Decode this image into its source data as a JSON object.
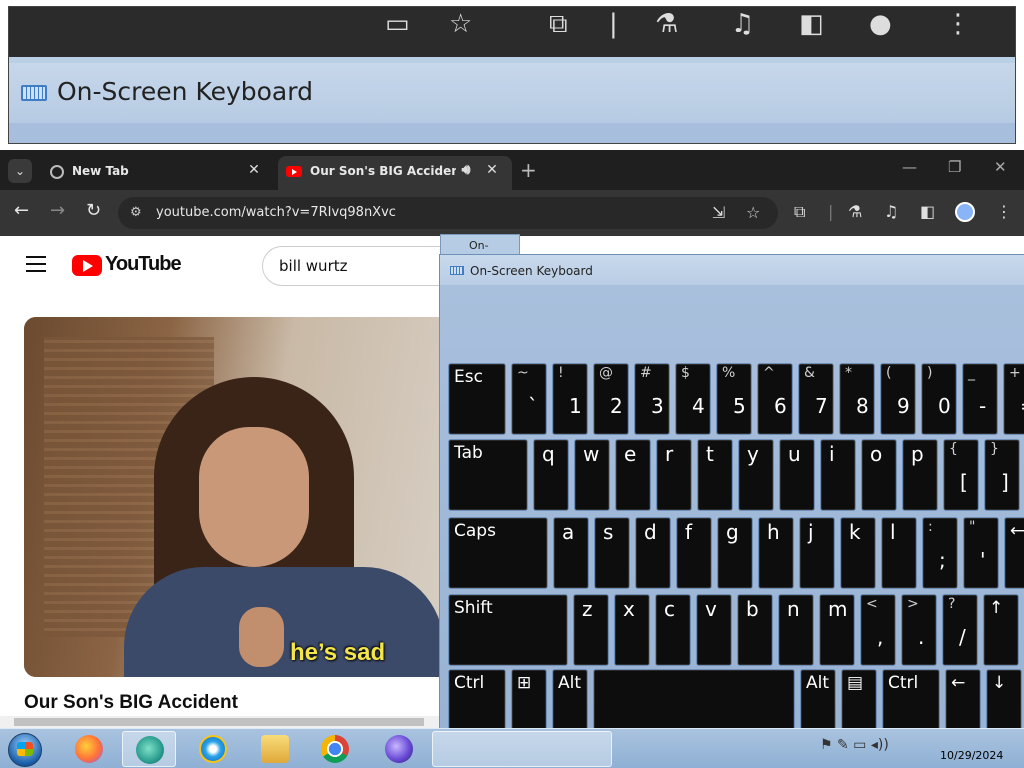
{
  "magnifier": {
    "title": "On-Screen Keyboard"
  },
  "chrome": {
    "tabs": [
      {
        "label": "New Tab",
        "close": "✕"
      },
      {
        "label": "Our Son's BIG Accident - Yo",
        "close": "✕"
      }
    ],
    "new_tab": "+",
    "window_controls": {
      "minimize": "—",
      "restore": "❐",
      "close": "✕"
    },
    "nav": {
      "back": "←",
      "forward": "→",
      "reload": "↻"
    },
    "url": "youtube.com/watch?v=7RIvq98nXvc"
  },
  "youtube": {
    "logo_text": "YouTube",
    "search_value": "bill wurtz",
    "caption": "he’s sad",
    "video_title": "Our Son's BIG Accident"
  },
  "osk": {
    "back_title": "On-Screen",
    "title": "On-Screen Keyboard",
    "rows": [
      [
        {
          "main": "Esc",
          "word": true
        },
        {
          "sub": "~",
          "main": "`"
        },
        {
          "sub": "!",
          "main": "1"
        },
        {
          "sub": "@",
          "main": "2"
        },
        {
          "sub": "#",
          "main": "3"
        },
        {
          "sub": "$",
          "main": "4"
        },
        {
          "sub": "%",
          "main": "5"
        },
        {
          "sub": "^",
          "main": "6"
        },
        {
          "sub": "&",
          "main": "7"
        },
        {
          "sub": "*",
          "main": "8"
        },
        {
          "sub": "(",
          "main": "9"
        },
        {
          "sub": ")",
          "main": "0"
        },
        {
          "sub": "_",
          "main": "-"
        },
        {
          "sub": "+",
          "main": "="
        }
      ],
      [
        {
          "main": "Tab",
          "word": true
        },
        {
          "main": "q"
        },
        {
          "main": "w"
        },
        {
          "main": "e"
        },
        {
          "main": "r"
        },
        {
          "main": "t"
        },
        {
          "main": "y"
        },
        {
          "main": "u"
        },
        {
          "main": "i"
        },
        {
          "main": "o"
        },
        {
          "main": "p"
        },
        {
          "sub": "{",
          "main": "["
        },
        {
          "sub": "}",
          "main": "]"
        }
      ],
      [
        {
          "main": "Caps",
          "word": true
        },
        {
          "main": "a"
        },
        {
          "main": "s"
        },
        {
          "main": "d"
        },
        {
          "main": "f"
        },
        {
          "main": "g"
        },
        {
          "main": "h"
        },
        {
          "main": "j"
        },
        {
          "main": "k"
        },
        {
          "main": "l"
        },
        {
          "sub": ":",
          "main": ";"
        },
        {
          "sub": "\"",
          "main": "'"
        },
        {
          "main": "⟵",
          "word": true
        }
      ],
      [
        {
          "main": "Shift",
          "word": true
        },
        {
          "main": "z"
        },
        {
          "main": "x"
        },
        {
          "main": "c"
        },
        {
          "main": "v"
        },
        {
          "main": "b"
        },
        {
          "main": "n"
        },
        {
          "main": "m"
        },
        {
          "sub": "<",
          "main": ","
        },
        {
          "sub": ">",
          "main": "."
        },
        {
          "sub": "?",
          "main": "/"
        },
        {
          "main": "↑",
          "word": true
        }
      ],
      [
        {
          "main": "Ctrl",
          "word": true
        },
        {
          "main": "⊞",
          "word": true
        },
        {
          "main": "Alt",
          "word": true
        },
        {
          "main": "",
          "word": true
        },
        {
          "main": "Alt",
          "word": true
        },
        {
          "main": "▤",
          "word": true
        },
        {
          "main": "Ctrl",
          "word": true
        },
        {
          "main": "←",
          "word": true
        },
        {
          "main": "↓",
          "word": true
        }
      ]
    ]
  },
  "taskbar": {
    "date": "10/29/2024"
  }
}
